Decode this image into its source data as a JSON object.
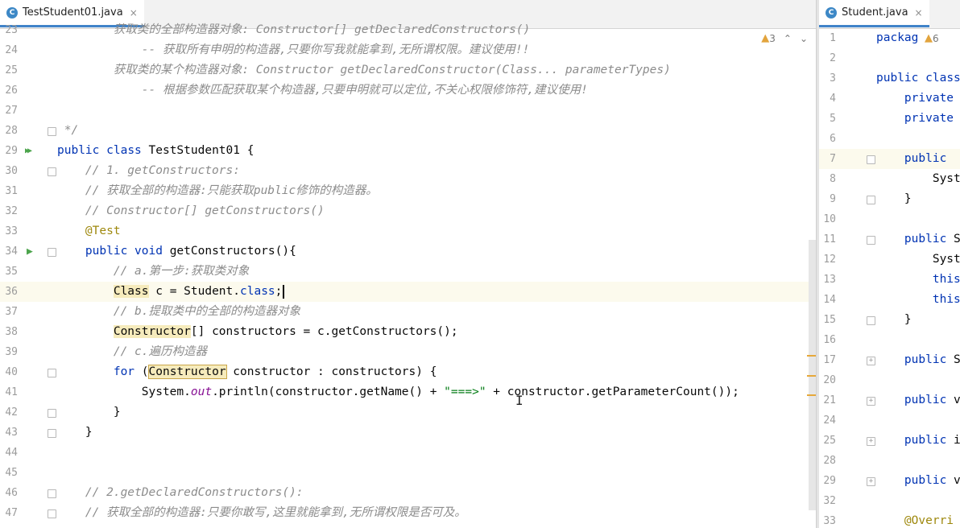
{
  "left_editor": {
    "tab": {
      "icon": "class-file-icon",
      "label": "TestStudent01.java",
      "close": "×"
    },
    "warnings": {
      "count": "3"
    },
    "lines": [
      {
        "n": "23",
        "code": "        获取类的全部构造器对象: Constructor[] getDeclaredConstructors()",
        "type": "comment"
      },
      {
        "n": "24",
        "code": "            -- 获取所有申明的构造器,只要你写我就能拿到,无所谓权限。建议使用!!",
        "type": "comment"
      },
      {
        "n": "25",
        "code": "        获取类的某个构造器对象: Constructor getDeclaredConstructor(Class... parameterTypes)",
        "type": "comment"
      },
      {
        "n": "26",
        "code": "            -- 根据参数匹配获取某个构造器,只要申明就可以定位,不关心权限修饰符,建议使用!",
        "type": "comment"
      },
      {
        "n": "27",
        "code": "",
        "type": "plain"
      },
      {
        "n": "28",
        "code": " */",
        "type": "comment"
      },
      {
        "n": "29",
        "code": "",
        "type": "classdecl"
      },
      {
        "n": "30",
        "code": "    // 1. getConstructors:",
        "type": "comment"
      },
      {
        "n": "31",
        "code": "    // 获取全部的构造器:只能获取public修饰的构造器。",
        "type": "comment"
      },
      {
        "n": "32",
        "code": "    // Constructor[] getConstructors()",
        "type": "comment"
      },
      {
        "n": "33",
        "code": "    @Test",
        "type": "annotation"
      },
      {
        "n": "34",
        "code": "",
        "type": "method"
      },
      {
        "n": "35",
        "code": "        // a.第一步:获取类对象",
        "type": "comment"
      },
      {
        "n": "36",
        "code": "",
        "type": "current"
      },
      {
        "n": "37",
        "code": "        // b.提取类中的全部的构造器对象",
        "type": "comment"
      },
      {
        "n": "38",
        "code": "",
        "type": "constructors"
      },
      {
        "n": "39",
        "code": "        // c.遍历构造器",
        "type": "comment"
      },
      {
        "n": "40",
        "code": "",
        "type": "for"
      },
      {
        "n": "41",
        "code": "",
        "type": "println"
      },
      {
        "n": "42",
        "code": "        }",
        "type": "plain"
      },
      {
        "n": "43",
        "code": "    }",
        "type": "plain"
      },
      {
        "n": "44",
        "code": "",
        "type": "plain"
      },
      {
        "n": "45",
        "code": "",
        "type": "plain"
      },
      {
        "n": "46",
        "code": "    // 2.getDeclaredConstructors():",
        "type": "comment"
      },
      {
        "n": "47",
        "code": "    // 获取全部的构造器:只要你敢写,这里就能拿到,无所谓权限是否可及。",
        "type": "comment"
      }
    ],
    "tokens": {
      "public": "public",
      "class": "class",
      "void": "void",
      "for": "for",
      "class_name": " TestStudent01 {",
      "method_rest": " getConstructors(){",
      "Class": "Class",
      "line36_rest": " c = Student.",
      "line36_end": ";",
      "Constructor": "Constructor",
      "line38_rest": "[] constructors = c.getConstructors();",
      "for_open": " (",
      "for_rest": " constructor : constructors) {",
      "println_a": "System.",
      "out": "out",
      "println_b": ".println(constructor.getName() + ",
      "arrow": "\"===>\"",
      "println_c": " + constructor.getParameterCount());"
    }
  },
  "right_editor": {
    "tab": {
      "icon": "class-file-icon",
      "label": "Student.java",
      "close": "×"
    },
    "warnings": {
      "count": "6"
    },
    "lines": [
      {
        "n": "1",
        "code": "packag",
        "type": "kw"
      },
      {
        "n": "2",
        "code": "",
        "type": "plain"
      },
      {
        "n": "3",
        "code": "public class",
        "type": "kw"
      },
      {
        "n": "4",
        "code": "    private",
        "type": "kw"
      },
      {
        "n": "5",
        "code": "    private",
        "type": "kw"
      },
      {
        "n": "6",
        "code": "",
        "type": "plain"
      },
      {
        "n": "7",
        "code": "    public",
        "type": "kw"
      },
      {
        "n": "8",
        "code": "        Syst",
        "type": "plain"
      },
      {
        "n": "9",
        "code": "    }",
        "type": "plain"
      },
      {
        "n": "10",
        "code": "",
        "type": "plain"
      },
      {
        "n": "11",
        "code": "    public S",
        "type": "kwmix"
      },
      {
        "n": "12",
        "code": "        Syst",
        "type": "plain"
      },
      {
        "n": "13",
        "code": "        this",
        "type": "kw"
      },
      {
        "n": "14",
        "code": "        this",
        "type": "kw"
      },
      {
        "n": "15",
        "code": "    }",
        "type": "plain"
      },
      {
        "n": "16",
        "code": "",
        "type": "plain"
      },
      {
        "n": "17",
        "code": "    public S",
        "type": "kwmix"
      },
      {
        "n": "20",
        "code": "",
        "type": "plain"
      },
      {
        "n": "21",
        "code": "    public v",
        "type": "kwmix"
      },
      {
        "n": "24",
        "code": "",
        "type": "plain"
      },
      {
        "n": "25",
        "code": "    public i",
        "type": "kwmix"
      },
      {
        "n": "28",
        "code": "",
        "type": "plain"
      },
      {
        "n": "29",
        "code": "    public v",
        "type": "kwmix"
      },
      {
        "n": "32",
        "code": "",
        "type": "plain"
      },
      {
        "n": "33",
        "code": "    @Overri",
        "type": "annotation"
      }
    ]
  },
  "colors": {
    "keyword": "#0033b3",
    "comment": "#8c8c8c",
    "annotation": "#9e880d",
    "string": "#067d17",
    "tab_accent": "#4083c9"
  }
}
